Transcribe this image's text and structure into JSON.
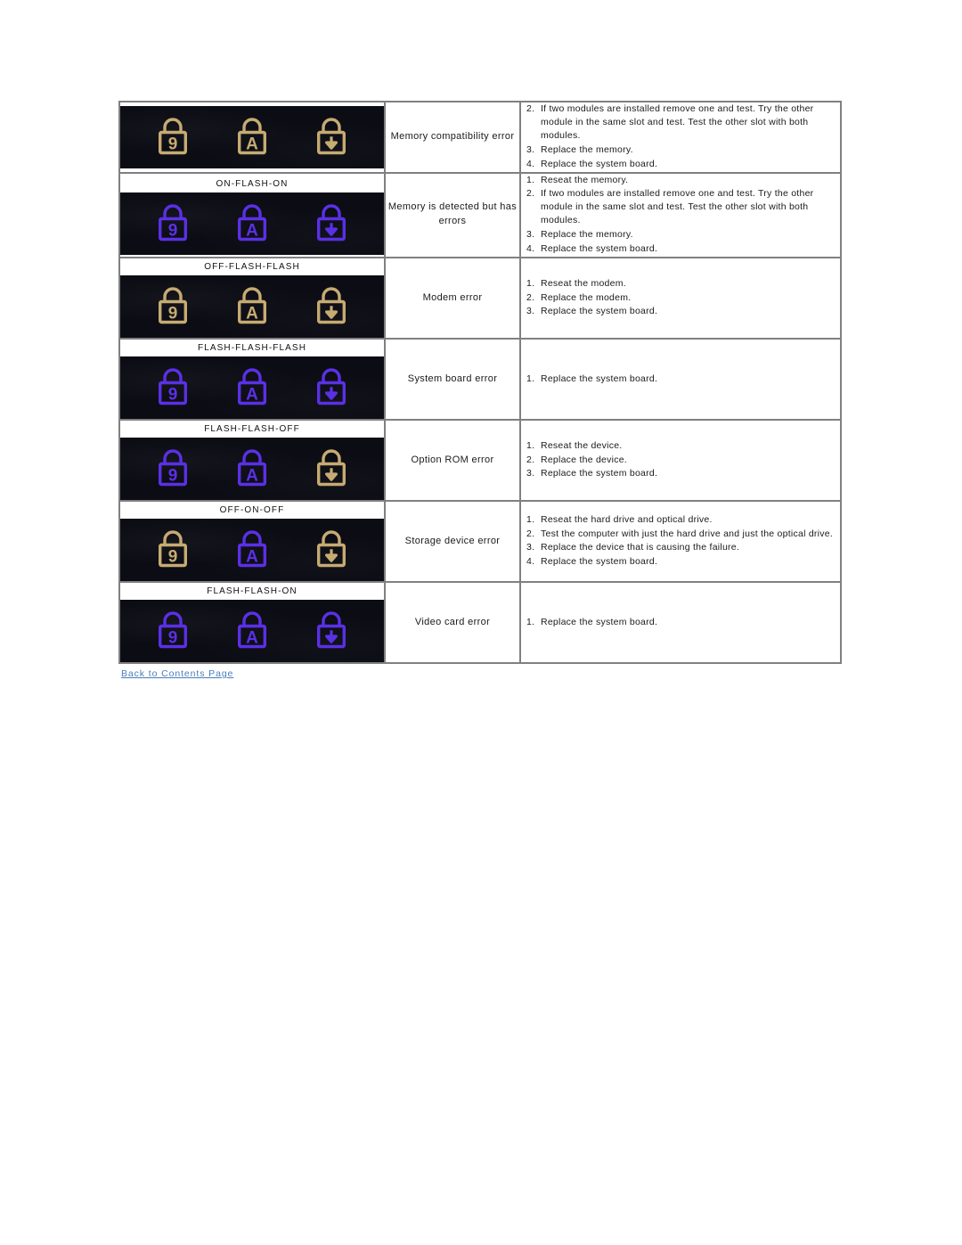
{
  "colors": {
    "led_on": "#c6ab72",
    "led_flash": "#5a30e6",
    "strip_background": "#0c0c14",
    "link": "#4a7ebb",
    "table_border": "#808080"
  },
  "table": {
    "rows": [
      {
        "state_label": "",
        "show_state_label": false,
        "leds": [
          {
            "icon": "num-lock-led-icon",
            "glyph": "9",
            "state": "on"
          },
          {
            "icon": "caps-lock-led-icon",
            "glyph": "A",
            "state": "on"
          },
          {
            "icon": "scroll-lock-led-icon",
            "glyph": "arrow-down",
            "state": "on"
          }
        ],
        "description": "Memory compatibility error",
        "steps": [
          {
            "num": "2.",
            "text": "If two modules are installed remove one and test. Try the other module in the same slot and test. Test the other slot with both modules."
          },
          {
            "num": "3.",
            "text": "Replace the memory."
          },
          {
            "num": "4.",
            "text": "Replace the system board."
          }
        ]
      },
      {
        "state_label": "ON-FLASH-ON",
        "show_state_label": true,
        "leds": [
          {
            "icon": "num-lock-led-icon",
            "glyph": "9",
            "state": "flash"
          },
          {
            "icon": "caps-lock-led-icon",
            "glyph": "A",
            "state": "flash"
          },
          {
            "icon": "scroll-lock-led-icon",
            "glyph": "arrow-down",
            "state": "flash"
          }
        ],
        "description": "Memory is detected but has errors",
        "steps": [
          {
            "num": "1.",
            "text": "Reseat the memory."
          },
          {
            "num": "2.",
            "text": "If two modules are installed remove one and test. Try the other module in the same slot and test. Test the other slot with both modules."
          },
          {
            "num": "3.",
            "text": "Replace the memory."
          },
          {
            "num": "4.",
            "text": "Replace the system board."
          }
        ]
      },
      {
        "state_label": "OFF-FLASH-FLASH",
        "show_state_label": true,
        "leds": [
          {
            "icon": "num-lock-led-icon",
            "glyph": "9",
            "state": "on"
          },
          {
            "icon": "caps-lock-led-icon",
            "glyph": "A",
            "state": "on"
          },
          {
            "icon": "scroll-lock-led-icon",
            "glyph": "arrow-down",
            "state": "on"
          }
        ],
        "description": "Modem error",
        "steps": [
          {
            "num": "1.",
            "text": "Reseat the modem."
          },
          {
            "num": "2.",
            "text": "Replace the modem."
          },
          {
            "num": "3.",
            "text": "Replace the system board."
          }
        ]
      },
      {
        "state_label": "FLASH-FLASH-FLASH",
        "show_state_label": true,
        "leds": [
          {
            "icon": "num-lock-led-icon",
            "glyph": "9",
            "state": "flash"
          },
          {
            "icon": "caps-lock-led-icon",
            "glyph": "A",
            "state": "flash"
          },
          {
            "icon": "scroll-lock-led-icon",
            "glyph": "arrow-down",
            "state": "flash"
          }
        ],
        "description": "System board error",
        "steps": [
          {
            "num": "1.",
            "text": "Replace the system board."
          }
        ]
      },
      {
        "state_label": "FLASH-FLASH-OFF",
        "show_state_label": true,
        "leds": [
          {
            "icon": "num-lock-led-icon",
            "glyph": "9",
            "state": "flash"
          },
          {
            "icon": "caps-lock-led-icon",
            "glyph": "A",
            "state": "flash"
          },
          {
            "icon": "scroll-lock-led-icon",
            "glyph": "arrow-down",
            "state": "on"
          }
        ],
        "description": "Option ROM error",
        "steps": [
          {
            "num": "1.",
            "text": "Reseat the device."
          },
          {
            "num": "2.",
            "text": "Replace the device."
          },
          {
            "num": "3.",
            "text": "Replace the system board."
          }
        ]
      },
      {
        "state_label": "OFF-ON-OFF",
        "show_state_label": true,
        "leds": [
          {
            "icon": "num-lock-led-icon",
            "glyph": "9",
            "state": "on"
          },
          {
            "icon": "caps-lock-led-icon",
            "glyph": "A",
            "state": "flash"
          },
          {
            "icon": "scroll-lock-led-icon",
            "glyph": "arrow-down",
            "state": "on"
          }
        ],
        "description": "Storage device error",
        "steps": [
          {
            "num": "1.",
            "text": "Reseat the hard drive and optical drive."
          },
          {
            "num": "2.",
            "text": "Test the computer with just the hard drive and just the optical drive."
          },
          {
            "num": "3.",
            "text": "Replace the device that is causing the failure."
          },
          {
            "num": "4.",
            "text": "Replace the system board."
          }
        ]
      },
      {
        "state_label": "FLASH-FLASH-ON",
        "show_state_label": true,
        "leds": [
          {
            "icon": "num-lock-led-icon",
            "glyph": "9",
            "state": "flash"
          },
          {
            "icon": "caps-lock-led-icon",
            "glyph": "A",
            "state": "flash"
          },
          {
            "icon": "scroll-lock-led-icon",
            "glyph": "arrow-down",
            "state": "flash"
          }
        ],
        "description": "Video card error",
        "steps": [
          {
            "num": "1.",
            "text": "Replace the system board."
          }
        ]
      }
    ]
  },
  "footer": {
    "back_link_label": "Back to Contents Page"
  }
}
